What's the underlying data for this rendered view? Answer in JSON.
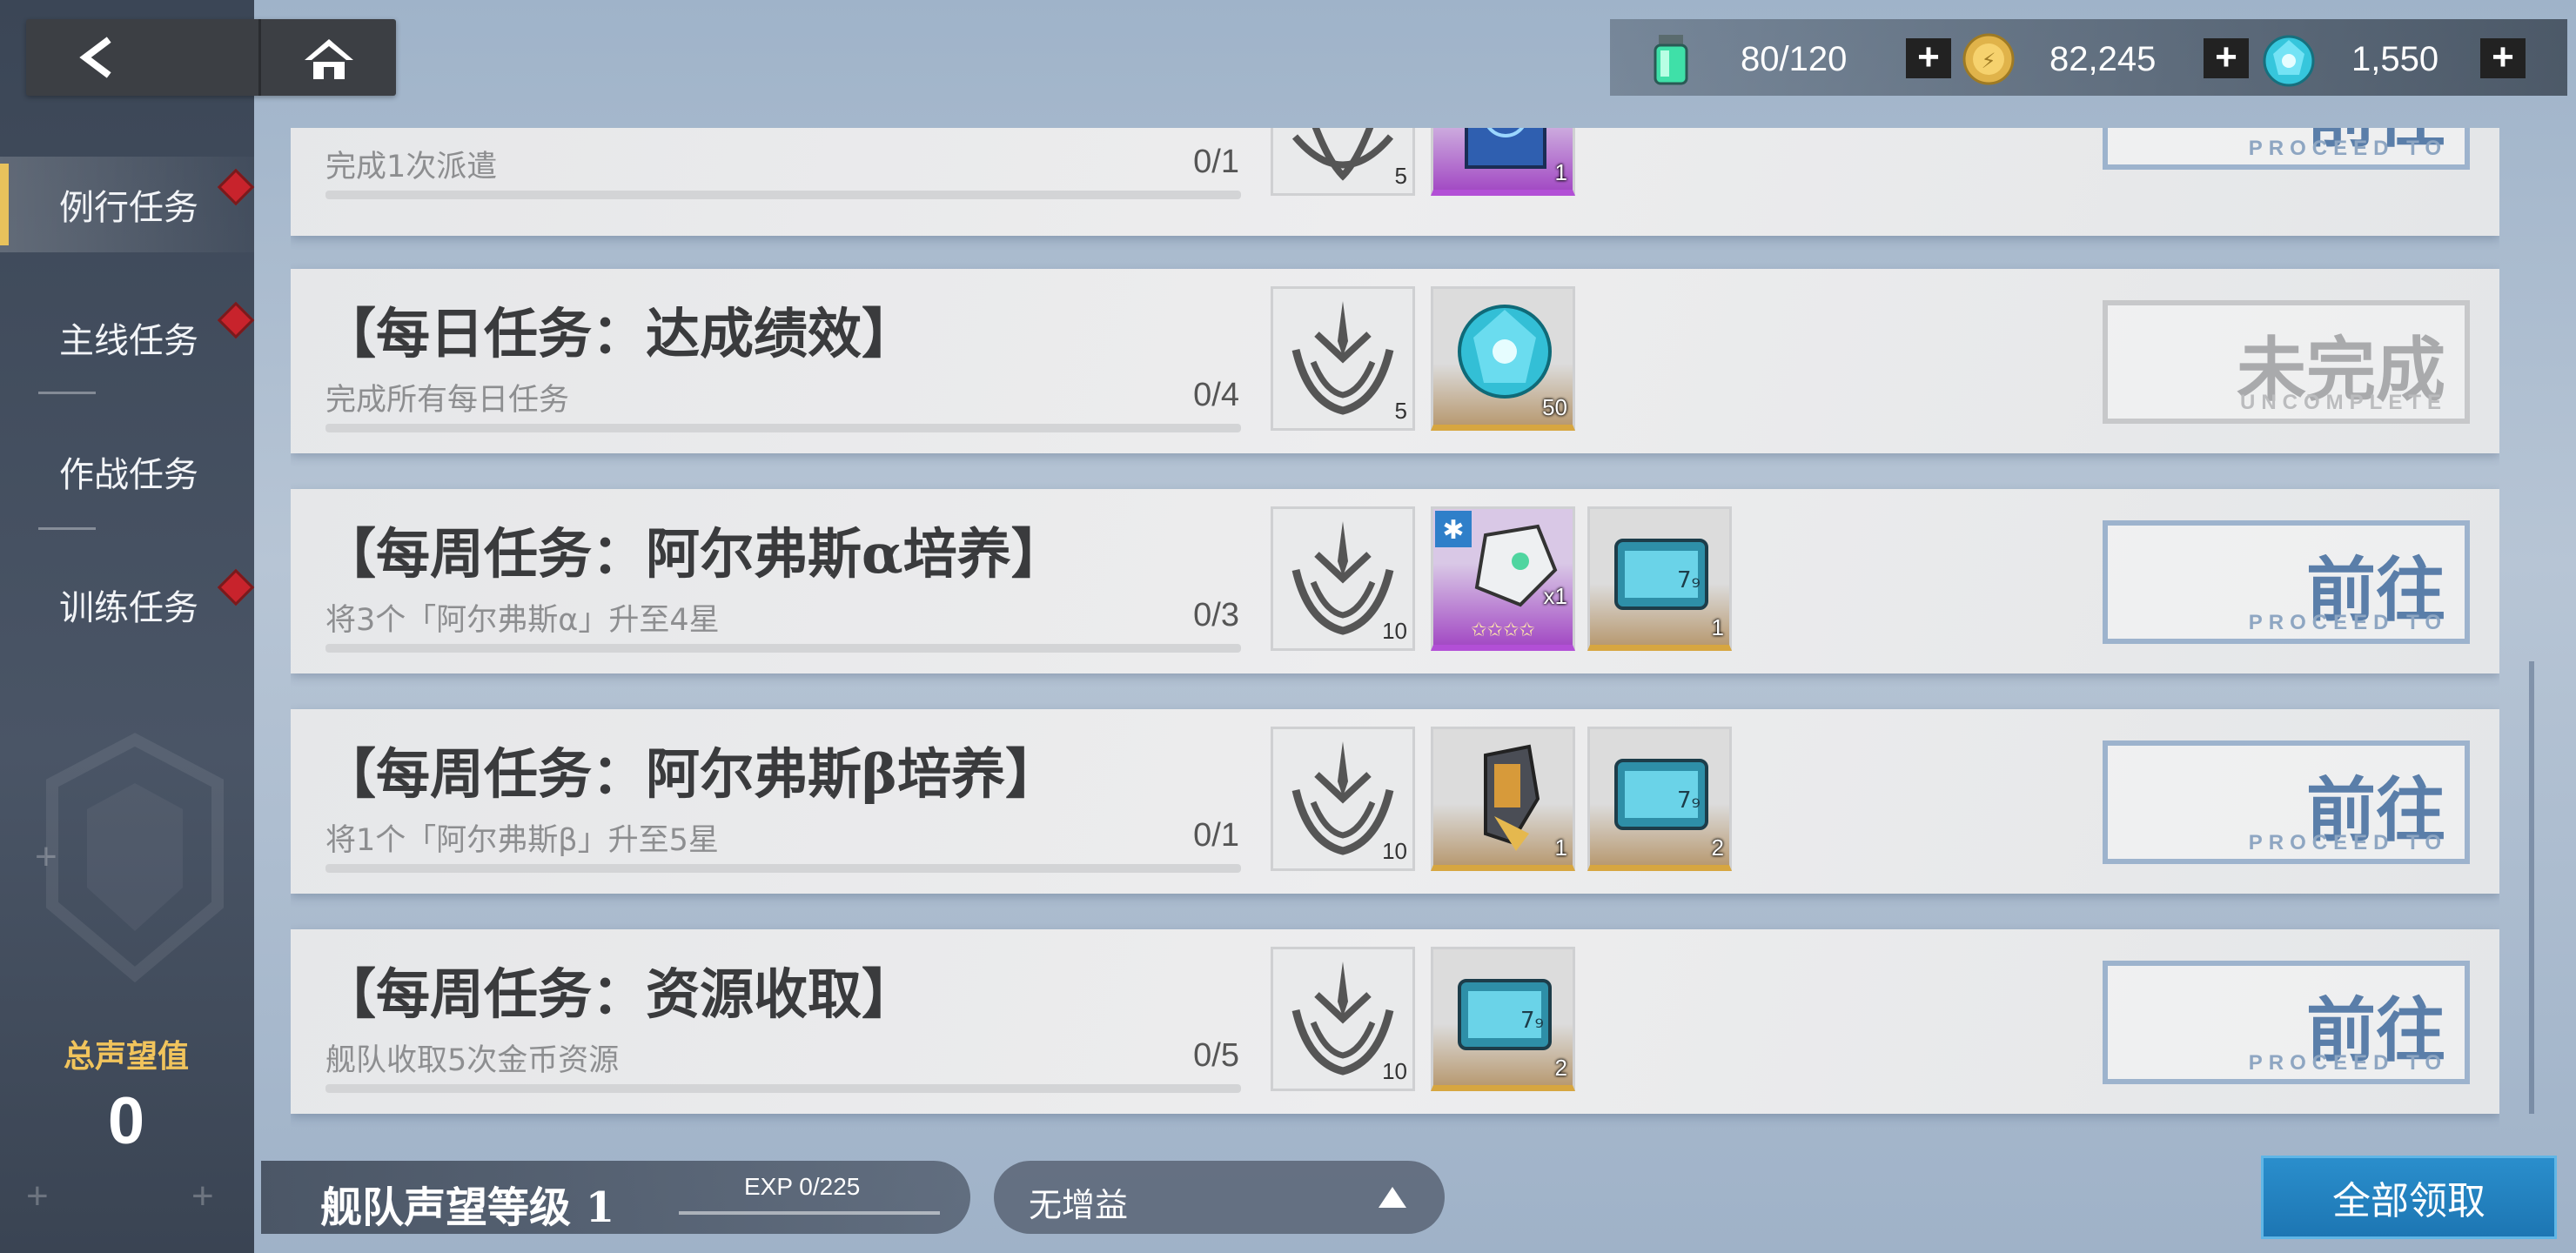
{
  "colors": {
    "accent": "#e8c25c",
    "action_blue": "#5a7ea9",
    "badge_red": "#c8232c",
    "claim_blue": "#1d76b3"
  },
  "top_nav": {
    "back_icon": "chevron-left-icon",
    "home_icon": "home-icon"
  },
  "currencies": [
    {
      "name": "stamina",
      "icon": "stamina-vial-icon",
      "value": "80/120"
    },
    {
      "name": "coins",
      "icon": "gold-coin-icon",
      "value": "82,245"
    },
    {
      "name": "crystal",
      "icon": "blue-crystal-icon",
      "value": "1,550"
    }
  ],
  "sidebar": {
    "items": [
      {
        "label": "例行任务",
        "active": true,
        "badge": true
      },
      {
        "label": "主线任务",
        "active": false,
        "badge": true
      },
      {
        "label": "作战任务",
        "active": false,
        "badge": false
      },
      {
        "label": "训练任务",
        "active": false,
        "badge": true
      }
    ],
    "reputation_label": "总声望值",
    "reputation_value": "0"
  },
  "tasks": [
    {
      "title": "",
      "desc": "完成1次派遣",
      "progress": "0/1",
      "rewards": [
        {
          "icon": "reputation-emblem-icon",
          "qty": "5"
        },
        {
          "icon": "blueprint-icon",
          "qty": "1"
        }
      ],
      "action": {
        "main": "前往",
        "sub": "PROCEED TO",
        "state": "proceed"
      }
    },
    {
      "title": "【每日任务：达成绩效】",
      "desc": "完成所有每日任务",
      "progress": "0/4",
      "rewards": [
        {
          "icon": "reputation-emblem-icon",
          "qty": "5"
        },
        {
          "icon": "blue-crystal-icon",
          "qty": "50"
        }
      ],
      "action": {
        "main": "未完成",
        "sub": "UNCOMPLETE",
        "state": "uncomplete"
      }
    },
    {
      "title": "【每周任务：阿尔弗斯α培养】",
      "desc": "将3个「阿尔弗斯α」升至4星",
      "progress": "0/3",
      "rewards": [
        {
          "icon": "reputation-emblem-icon",
          "qty": "10"
        },
        {
          "icon": "mecha-unit-card-icon",
          "qty": "x1"
        },
        {
          "icon": "data-chip-icon",
          "qty": "1"
        }
      ],
      "action": {
        "main": "前往",
        "sub": "PROCEED TO",
        "state": "proceed"
      }
    },
    {
      "title": "【每周任务：阿尔弗斯β培养】",
      "desc": "将1个「阿尔弗斯β」升至5星",
      "progress": "0/1",
      "rewards": [
        {
          "icon": "reputation-emblem-icon",
          "qty": "10"
        },
        {
          "icon": "upgrade-part-icon",
          "qty": "1"
        },
        {
          "icon": "data-chip-icon",
          "qty": "2"
        }
      ],
      "action": {
        "main": "前往",
        "sub": "PROCEED TO",
        "state": "proceed"
      }
    },
    {
      "title": "【每周任务：资源收取】",
      "desc": "舰队收取5次金币资源",
      "progress": "0/5",
      "rewards": [
        {
          "icon": "reputation-emblem-icon",
          "qty": "10"
        },
        {
          "icon": "data-chip-icon",
          "qty": "2"
        }
      ],
      "action": {
        "main": "前往",
        "sub": "PROCEED TO",
        "state": "proceed"
      }
    }
  ],
  "bottom": {
    "fleet_label": "舰队声望等级 1",
    "exp_text": "EXP  0/225",
    "buff_label": "无增益",
    "claim_all": "全部领取"
  }
}
